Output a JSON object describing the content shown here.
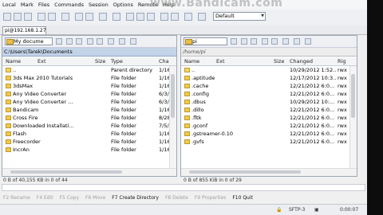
{
  "menu": [
    "Local",
    "Mark",
    "Files",
    "Commands",
    "Session",
    "Options",
    "Remote",
    "Help"
  ],
  "watermark": "www.Bandicam.com",
  "toolbar": {
    "transfer_setting": "Default"
  },
  "session_tab": "pi@192.168.1.27",
  "left": {
    "drive": "My docume",
    "path": "C:\\Users\\Tarek\\Documents",
    "columns": {
      "name": "Name",
      "ext": "Ext",
      "size": "Size",
      "type": "Type",
      "changed": "Cha"
    },
    "rows": [
      {
        "name": "..",
        "type": "Parent directory",
        "changed": "1/16"
      },
      {
        "name": "3ds Max 2010 Tutorials",
        "type": "File folder",
        "changed": "1/16"
      },
      {
        "name": "3dsMax",
        "type": "File folder",
        "changed": "1/16"
      },
      {
        "name": "Any Video Converter",
        "type": "File folder",
        "changed": "6/3/"
      },
      {
        "name": "Any Video Converter ...",
        "type": "File folder",
        "changed": "6/3/"
      },
      {
        "name": "Bandicam",
        "type": "File folder",
        "changed": "1/16"
      },
      {
        "name": "Cross Fire",
        "type": "File folder",
        "changed": "8/28"
      },
      {
        "name": "Downloaded Installati...",
        "type": "File folder",
        "changed": "7/5/"
      },
      {
        "name": "Flash",
        "type": "File folder",
        "changed": "1/16"
      },
      {
        "name": "Freecorder",
        "type": "File folder",
        "changed": "1/16"
      },
      {
        "name": "IncrAn",
        "type": "File folder",
        "changed": "1/16"
      }
    ],
    "status": "0 B of 40,155 KB in 0 of 44"
  },
  "right": {
    "drive": "pi",
    "path": "/home/pi",
    "columns": {
      "name": "Name",
      "ext": "Ext",
      "size": "Size",
      "changed": "Changed",
      "rights": "Rig"
    },
    "rows": [
      {
        "name": "..",
        "changed": "10/29/2012 1:52...",
        "rights": "rwx"
      },
      {
        "name": ".aptitude",
        "changed": "12/17/2012 10:3...",
        "rights": "rwx"
      },
      {
        "name": ".cache",
        "changed": "12/21/2012 6:0...",
        "rights": "rwx"
      },
      {
        "name": ".config",
        "changed": "12/21/2012 6:0...",
        "rights": "rwx"
      },
      {
        "name": ".dbus",
        "changed": "10/29/2012 10:...",
        "rights": "rwx"
      },
      {
        "name": ".dillo",
        "changed": "12/21/2012 6:0...",
        "rights": "rwx"
      },
      {
        "name": ".fltk",
        "changed": "12/21/2012 6:0...",
        "rights": "rwx"
      },
      {
        "name": ".gconf",
        "changed": "12/21/2012 6:0...",
        "rights": "rwx"
      },
      {
        "name": ".gstreamer-0.10",
        "changed": "12/21/2012 6:0...",
        "rights": "rwx"
      },
      {
        "name": ".gvfs",
        "changed": "12/21/2012 6:0...",
        "rights": "rwx"
      }
    ],
    "status": "0 B of 855 KiB in 0 of 29"
  },
  "fkeys": [
    {
      "label": "F2 Rename",
      "enabled": false
    },
    {
      "label": "F4 Edit",
      "enabled": false
    },
    {
      "label": "F5 Copy",
      "enabled": false
    },
    {
      "label": "F6 Move",
      "enabled": false
    },
    {
      "label": "F7 Create Directory",
      "enabled": true
    },
    {
      "label": "F8 Delete",
      "enabled": false
    },
    {
      "label": "F9 Properties",
      "enabled": false
    },
    {
      "label": "F10 Quit",
      "enabled": true
    }
  ],
  "statusbar": {
    "protocol": "SFTP-3",
    "time": "0:00:07"
  }
}
